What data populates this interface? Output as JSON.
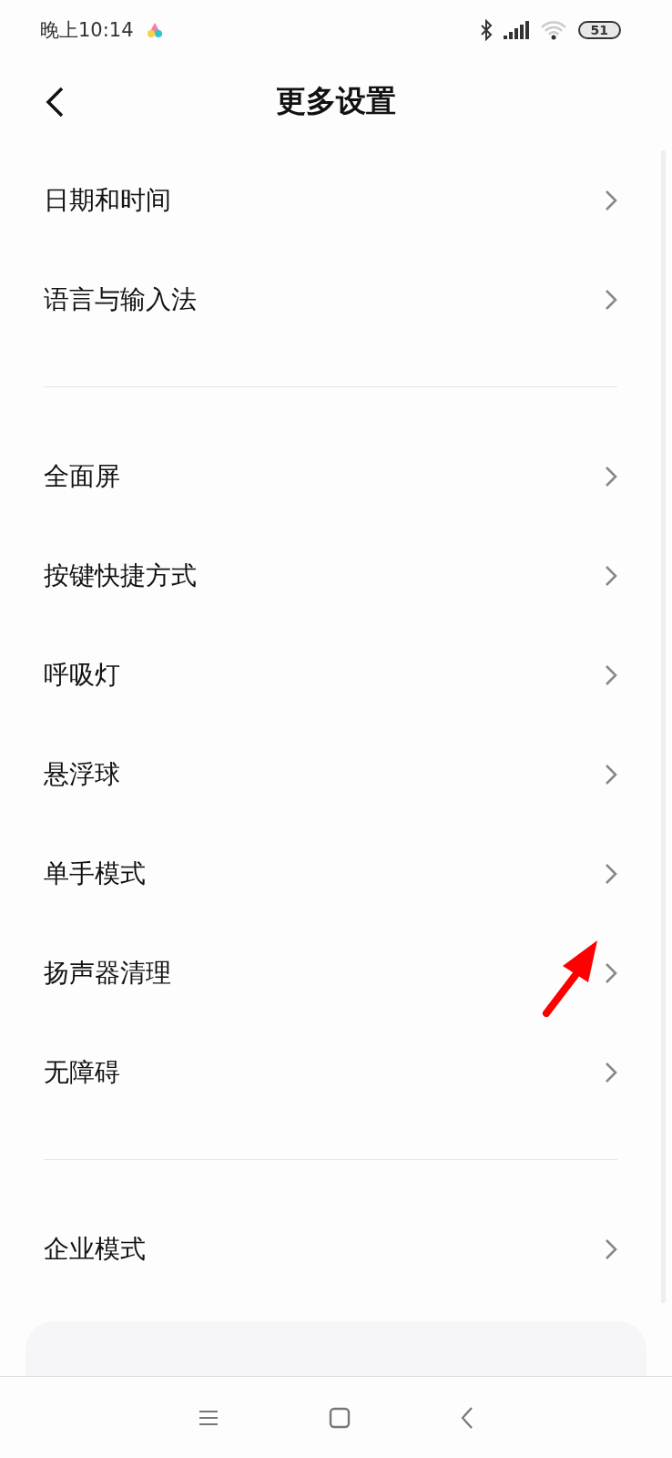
{
  "status_bar": {
    "time": "晚上10:14",
    "battery": "51"
  },
  "header": {
    "title": "更多设置"
  },
  "sections": [
    {
      "items": [
        {
          "label": "日期和时间"
        },
        {
          "label": "语言与输入法"
        }
      ]
    },
    {
      "items": [
        {
          "label": "全面屏"
        },
        {
          "label": "按键快捷方式"
        },
        {
          "label": "呼吸灯"
        },
        {
          "label": "悬浮球"
        },
        {
          "label": "单手模式"
        },
        {
          "label": "扬声器清理"
        },
        {
          "label": "无障碍"
        }
      ]
    },
    {
      "items": [
        {
          "label": "企业模式"
        }
      ]
    }
  ]
}
